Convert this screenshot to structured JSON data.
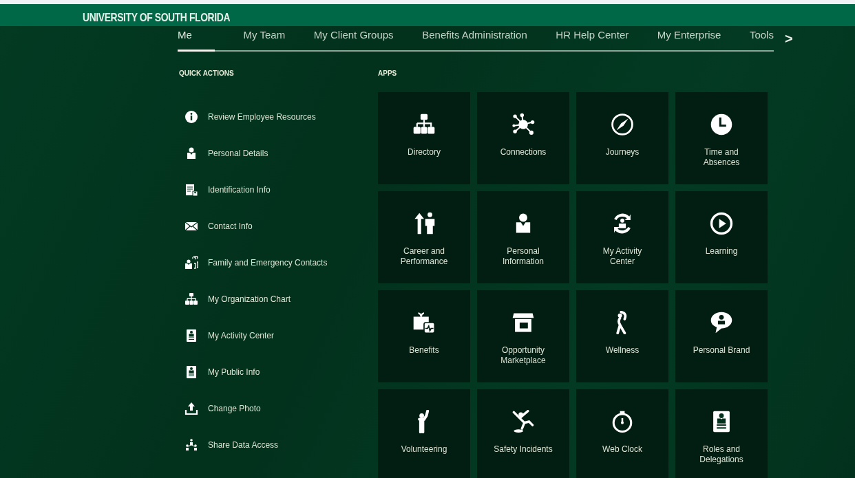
{
  "header": {
    "logo_text": "UNIVERSITY OF SOUTH FLORIDA"
  },
  "tabs": [
    {
      "label": "Me",
      "selected": true
    },
    {
      "label": "My Team",
      "selected": false
    },
    {
      "label": "My Client Groups",
      "selected": false
    },
    {
      "label": "Benefits Administration",
      "selected": false
    },
    {
      "label": "HR Help Center",
      "selected": false
    },
    {
      "label": "My Enterprise",
      "selected": false
    },
    {
      "label": "Tools",
      "selected": false
    }
  ],
  "tabs_next": ">",
  "quick_actions": {
    "title": "QUICK ACTIONS",
    "items": [
      {
        "label": "Review Employee Resources"
      },
      {
        "label": "Personal Details"
      },
      {
        "label": "Identification Info"
      },
      {
        "label": "Contact Info"
      },
      {
        "label": "Family and Emergency Contacts"
      },
      {
        "label": "My Organization Chart"
      },
      {
        "label": "My Activity Center"
      },
      {
        "label": "My Public Info"
      },
      {
        "label": "Change Photo"
      },
      {
        "label": "Share Data Access"
      }
    ]
  },
  "apps": {
    "title": "APPS",
    "items": [
      {
        "label": "Directory"
      },
      {
        "label": "Connections"
      },
      {
        "label": "Journeys"
      },
      {
        "label": "Time and Absences"
      },
      {
        "label": "Career and Performance"
      },
      {
        "label": "Personal Information"
      },
      {
        "label": "My Activity Center"
      },
      {
        "label": "Learning"
      },
      {
        "label": "Benefits"
      },
      {
        "label": "Opportunity Marketplace"
      },
      {
        "label": "Wellness"
      },
      {
        "label": "Personal Brand"
      },
      {
        "label": "Volunteering"
      },
      {
        "label": "Safety Incidents"
      },
      {
        "label": "Web Clock"
      },
      {
        "label": "Roles and Delegations"
      }
    ]
  }
}
